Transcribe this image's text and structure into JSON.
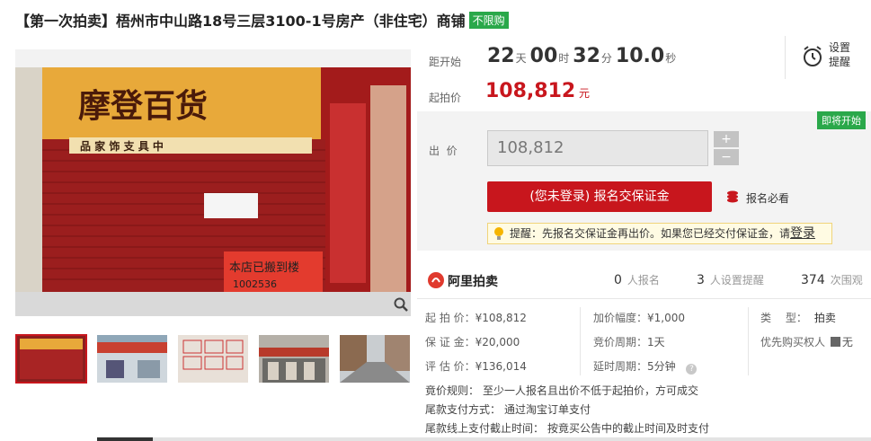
{
  "title": {
    "text": "【第一次拍卖】梧州市中山路18号三层3100-1号房产（非住宅）商铺",
    "badge": "不限购"
  },
  "gallery": {
    "sign_main": "摩登百货",
    "sign_sub": "品 家 饰 支 具 中",
    "notice_text": "本店已搬到楼",
    "notice_phone": "1002536"
  },
  "countdown": {
    "label": "距开始",
    "days": "22",
    "days_unit": "天",
    "hours": "00",
    "hours_unit": "时",
    "minutes": "32",
    "minutes_unit": "分",
    "seconds": "10.0",
    "seconds_unit": "秒"
  },
  "remind": {
    "line1": "设置",
    "line2": "提醒"
  },
  "start_price": {
    "label": "起拍价",
    "value": "108,812",
    "unit": "元"
  },
  "status_badge": "即将开始",
  "bid": {
    "label": "出  价",
    "value": "108,812",
    "plus": "+",
    "minus": "−"
  },
  "main_button": "(您未登录) 报名交保证金",
  "must_read": "报名必看",
  "tip": {
    "text": "提醒：先报名交保证金再出价。如果您已经交付保证金，请",
    "link": "登录"
  },
  "platform": {
    "name": "阿里拍卖",
    "signups": "0",
    "signups_label": "人报名",
    "reminders": "3",
    "reminders_label": "人设置提醒",
    "views": "374",
    "views_label": "次围观"
  },
  "details": {
    "start_price_label": "起 拍 价：",
    "start_price": "¥108,812",
    "deposit_label": "保 证 金：",
    "deposit": "¥20,000",
    "appraisal_label": "评 估 价：",
    "appraisal": "¥136,014",
    "increment_label": "加价幅度：",
    "increment": "¥1,000",
    "cycle_label": "竞价周期：",
    "cycle": "1天",
    "delay_label": "延时周期：",
    "delay": "5分钟",
    "type_label": "类　 型：",
    "type": "拍卖",
    "priority_label": "优先购买权人",
    "priority": "无"
  },
  "rules": {
    "bid_rule_label": "竟价规则：",
    "bid_rule": "至少一人报名且出价不低于起拍价，方可成交",
    "final_pay_label": "尾款支付方式：",
    "final_pay": "通过淘宝订单支付",
    "deadline_label": "尾款线上支付截止时间：",
    "deadline": "按竟买公告中的截止时间及时支付"
  },
  "colors": {
    "accent_red": "#c8161d",
    "green": "#2aa84a",
    "panel_gray": "#f3f3f3"
  }
}
